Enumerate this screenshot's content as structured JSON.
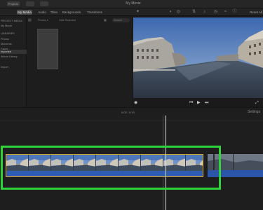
{
  "titlebar": {
    "buttons": [
      "Projects",
      "",
      ""
    ],
    "title": "My Movie"
  },
  "tabs": [
    {
      "label": "My Media",
      "active": true
    },
    {
      "label": "Audio",
      "active": false
    },
    {
      "label": "Titles",
      "active": false
    },
    {
      "label": "Backgrounds",
      "active": false
    },
    {
      "label": "Transitions",
      "active": false
    }
  ],
  "toolbar_icons": [
    "wand-icon",
    "palette-icon",
    "crop-icon",
    "stabilize-icon",
    "volume-icon",
    "speed-icon",
    "info-icon"
  ],
  "reset_label": "Reset All",
  "sidebar": {
    "items": [
      {
        "label": "PROJECT MEDIA",
        "selected": false
      },
      {
        "label": "My Movie",
        "selected": false
      },
      {
        "label": "LIBRARIES",
        "selected": false
      },
      {
        "label": "Photos",
        "selected": false
      },
      {
        "label": "Moments",
        "selected": false
      },
      {
        "label": "Faces",
        "selected": false
      },
      {
        "label": "Imported",
        "selected": true
      },
      {
        "label": "iMovie Library",
        "selected": false
      },
      {
        "label": "",
        "selected": false
      },
      {
        "label": "Import",
        "selected": false
      }
    ]
  },
  "browser": {
    "filter_label": "Photos ▾",
    "hide_label": "Hide Rejected",
    "search_placeholder": "Search"
  },
  "timeline": {
    "time_label": "0:02 / 0:10",
    "settings_label": "Settings"
  },
  "colors": {
    "highlight": "#2fd33a",
    "clip_border": "#d7a62b",
    "audio": "#2e5db3"
  }
}
